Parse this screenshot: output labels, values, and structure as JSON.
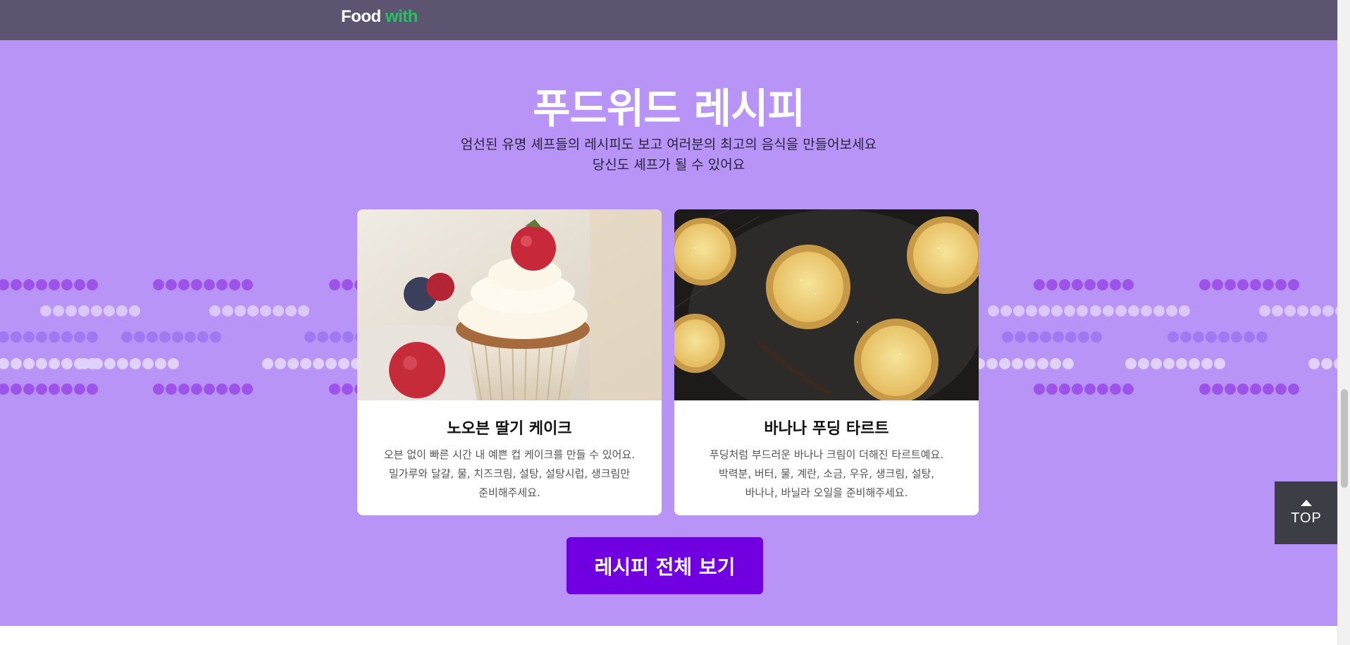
{
  "header": {
    "logo_food": "Food",
    "logo_with": "with"
  },
  "section": {
    "title": "푸드위드 레시피",
    "desc_line1": "엄선된 유명 셰프들의 레시피도 보고 여러분의 최고의 음식을 만들어보세요",
    "desc_line2": "당신도 셰프가 될 수 있어요"
  },
  "recipes": [
    {
      "title": "노오븐 딸기 케이크",
      "description": "오븐 없이 빠른 시간 내 예쁜 컵 케이크를 만들 수 있어요.\n밀가루와 달걀, 물, 치즈크림, 설탕, 설탕시럽, 생크림만\n준비해주세요."
    },
    {
      "title": "바나나 푸딩 타르트",
      "description": "푸딩처럼 부드러운 바나나 크림이 더해진 타르트예요.\n박력분, 버터, 물, 계란, 소금, 우유, 생크림, 설탕,\n바나나, 바닐라 오일을 준비해주세요."
    }
  ],
  "buttons": {
    "view_all": "레시피 전체 보기",
    "top": "TOP"
  },
  "colors": {
    "header_bg": "#5c5470",
    "section_bg": "#b794f6",
    "accent_button": "#7000e0",
    "logo_green": "#22c55e",
    "top_button_bg": "#3d3d45"
  },
  "icons": {
    "top_arrow": "arrow-up-icon"
  }
}
